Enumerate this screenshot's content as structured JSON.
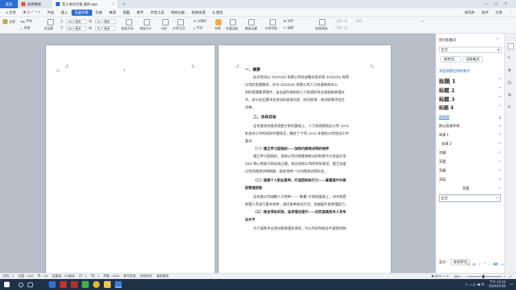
{
  "titlebar": {
    "home_tab": "首页",
    "tabs": [
      {
        "label": "稻壳模板"
      },
      {
        "label": "员工培训方案 最终.wps"
      }
    ],
    "add_tab": "+"
  },
  "menubar": {
    "file": "≡ 文件",
    "items": [
      "开始",
      "插入",
      "页面布局",
      "引用",
      "审阅",
      "视图",
      "章节",
      "开发工具",
      "特色功能",
      "稻壳资源"
    ],
    "active": "页面布局",
    "search": "Q 查找",
    "right": [
      "未同步",
      "协作",
      "分享"
    ]
  },
  "toolbar": {
    "theme": "主题",
    "font": "字体",
    "effect": "效果",
    "margins": "页边距",
    "top_label": "上:",
    "top_val": "25.4 毫米",
    "bottom_label": "下:",
    "bottom_val": "25.4 毫米",
    "left_label": "左:",
    "left_val": "31.7 毫米",
    "right_label": "右:",
    "right_val": "31.7 毫米",
    "orientation": "纸张方向",
    "size": "纸张大小",
    "columns": "分栏",
    "text_direction": "文字方向",
    "line_numbers": "行号",
    "breaks": "分隔符",
    "background": "背景",
    "page_border": "页面边框",
    "draft_setting": "稿纸设置",
    "wrap": "文字环绕",
    "align": "对齐",
    "rotate": "旋转",
    "select_pane": "选择窗格",
    "bring_forward": "上移一层",
    "send_backward": "下移一层",
    "group": "组合"
  },
  "document": {
    "page2": {
      "h1": "一、概要",
      "p1": [
        "此次培训从 XXXXXX 有限公司的战略出发实现 XXXXXX 有限",
        "公司的发展脚步，针对 XXXXXX 有限公司人力资源和和本公",
        "司的发展要求展开，旨在提升组织的人力资源的专业技能和管理水",
        "平。本计划主要涉及培训的具体内容、时间安排、培训效果评估方",
        "式等。"
      ],
      "h2": "二、总体目标",
      "p2": [
        "在年度培训需求调查分析的基础上，人力资源部结合公司 2016",
        "年培训工作的实际开展情况，确定了下列 2018 年度的公司培训工作",
        "重点："
      ],
      "s1": "（一）建立学习型组织——加快内部培训师的培养",
      "p3": [
        "建立学习型组织，加快公司内部各种知识的积累与分享是打造",
        "XXX 核心竞争力的必由之路，结合目前公司的实际情况，建立完善",
        "公司内部培训师制度，逐步培养一只内部培训师队伍。"
      ],
      "s2a": "（二）提高个人职业素养，打造团体执行力——着重提升中高",
      "s2b": "层管理技能",
      "p4": [
        "在实施公司战略人才培养——“鲁鹰”计划的基础上，对中高层",
        "管理人员进行重点培养，通过各种培训方式，全面提升其管理能力，"
      ],
      "s3a": "（三）结合项目实际，追求理论提升——切实提高技术人员专",
      "s3b": "业水平",
      "p5": [
        "为了提高专业培训系统理论讲授，与公司实际结合不紧密的缺"
      ]
    }
  },
  "stylepanel": {
    "title": "样式和格式",
    "current": "正文",
    "new_style": "新样式...",
    "clear_format": "清除格式",
    "section_label": "请选择要应用的格式",
    "styles": [
      {
        "label": "标题 1",
        "mark": "↵",
        "cls": "h"
      },
      {
        "label": "标题 2",
        "mark": "↵",
        "cls": "h"
      },
      {
        "label": "标题 3",
        "mark": "↵",
        "cls": "h"
      },
      {
        "label": "标题 4",
        "mark": "↵",
        "cls": "h"
      },
      {
        "label": "超链接",
        "mark": "a",
        "cls": "link"
      },
      {
        "label": "默认段落字体",
        "mark": "a",
        "cls": "n"
      },
      {
        "label": "目录 1",
        "mark": "↵",
        "cls": "n"
      },
      {
        "label": "目录 2",
        "mark": "↵",
        "cls": "n"
      },
      {
        "label": "日期",
        "mark": "↵",
        "cls": "n"
      },
      {
        "label": "页眉",
        "mark": "↵",
        "cls": "n"
      },
      {
        "label": "页脚",
        "mark": "↵",
        "cls": "n"
      },
      {
        "label": "页码",
        "mark": "a",
        "cls": "n"
      },
      {
        "label": "页眉",
        "mark": "↵",
        "cls": "c"
      },
      {
        "label": "正文",
        "mark": "↵",
        "cls": "box"
      }
    ],
    "show_label": "显示：",
    "show_value": "有效样式"
  },
  "statusbar": {
    "page": "页码：1",
    "pages": "页面：1/10",
    "section": "节：1/2",
    "setting": "设置值：2.5厘米",
    "line": "行：1",
    "col": "列：1",
    "words": "字数：3712",
    "spell": "拼写检查",
    "compare": "文档校对",
    "mode": "兼容模式",
    "zoom": "80%"
  },
  "taskbar": {
    "time": "下午 15:16",
    "date": "2024/01/06"
  },
  "colors": {
    "accent": "#2b6fd6",
    "taskbar": "#1f3147",
    "workarea": "#b8bfc8"
  }
}
